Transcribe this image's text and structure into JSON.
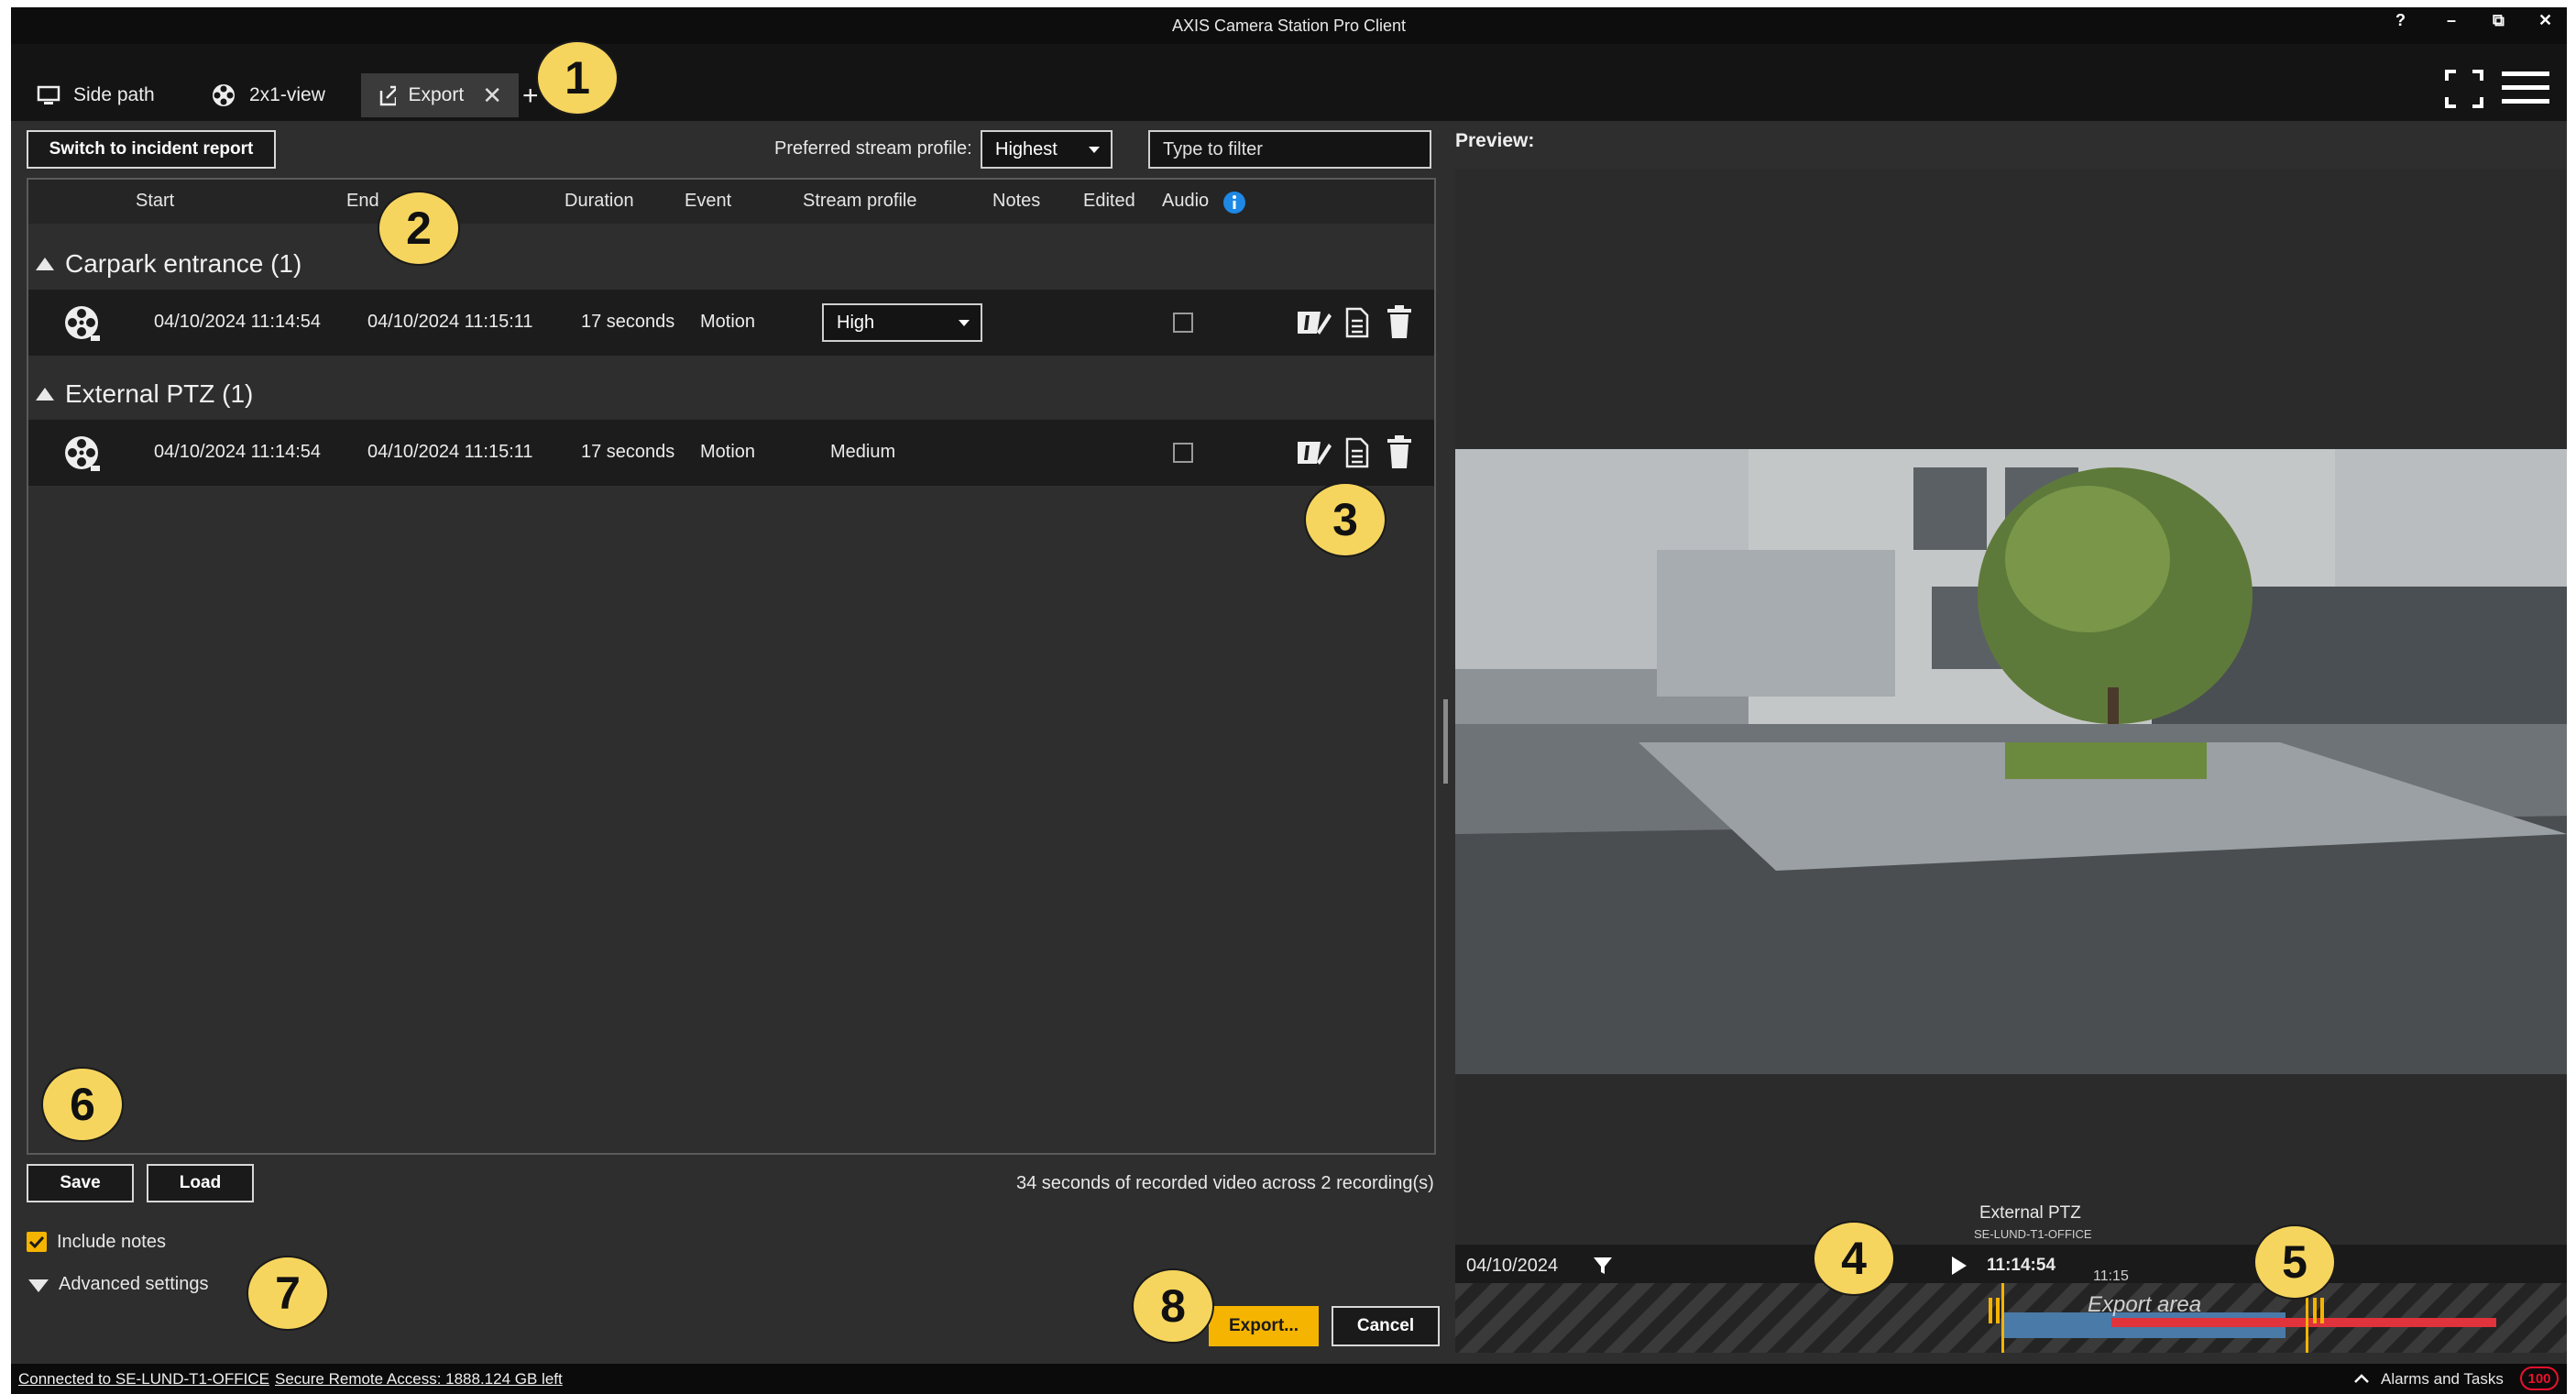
{
  "app": {
    "title": "AXIS Camera Station Pro Client"
  },
  "window_controls": {
    "help": "?",
    "minimize": "–",
    "restore": "⧉",
    "close": "✕"
  },
  "tabs": [
    {
      "label": "Side path",
      "icon": "monitor-icon"
    },
    {
      "label": "2x1-view",
      "icon": "film-reel-icon"
    },
    {
      "label": "Export",
      "icon": "export-icon",
      "active": true
    }
  ],
  "toolbar": {
    "switch_label": "Switch to incident report",
    "stream_profile_label": "Preferred stream profile:",
    "stream_profile_value": "Highest",
    "filter_placeholder": "Type to filter"
  },
  "table": {
    "columns": [
      "Start",
      "End",
      "Duration",
      "Event",
      "Stream profile",
      "Notes",
      "Edited",
      "Audio"
    ],
    "groups": [
      {
        "name": "Carpark entrance (1)",
        "rows": [
          {
            "start": "04/10/2024 11:14:54",
            "end": "04/10/2024 11:15:11",
            "duration": "17 seconds",
            "event": "Motion",
            "profile": "High",
            "audio": false
          }
        ]
      },
      {
        "name": "External PTZ (1)",
        "rows": [
          {
            "start": "04/10/2024 11:14:54",
            "end": "04/10/2024 11:15:11",
            "duration": "17 seconds",
            "event": "Motion",
            "profile": "Medium",
            "audio": false
          }
        ]
      }
    ]
  },
  "footer": {
    "save_label": "Save",
    "load_label": "Load",
    "summary": "34 seconds of recorded video across 2 recording(s)",
    "include_notes_label": "Include notes",
    "include_notes_checked": true,
    "advanced_label": "Advanced settings",
    "export_label": "Export...",
    "cancel_label": "Cancel"
  },
  "preview": {
    "label": "Preview:",
    "camera_name": "External PTZ",
    "camera_server": "SE-LUND-T1-OFFICE",
    "date": "04/10/2024",
    "time": "11:14:54",
    "tick": "11:15",
    "export_area_label": "Export area"
  },
  "status": {
    "connection": "Connected to SE-LUND-T1-OFFICE",
    "remote_access": "Secure Remote Access: 1888.124 GB left",
    "alarms_label": "Alarms and Tasks",
    "alarms_count": "100"
  },
  "callouts": [
    "1",
    "2",
    "3",
    "4",
    "5",
    "6",
    "7",
    "8"
  ],
  "colors": {
    "accent": "#f5b400",
    "callout": "#f6d55e",
    "alarm": "#e8112d",
    "export_area": "#e0333c",
    "info": "#1e88e5"
  }
}
